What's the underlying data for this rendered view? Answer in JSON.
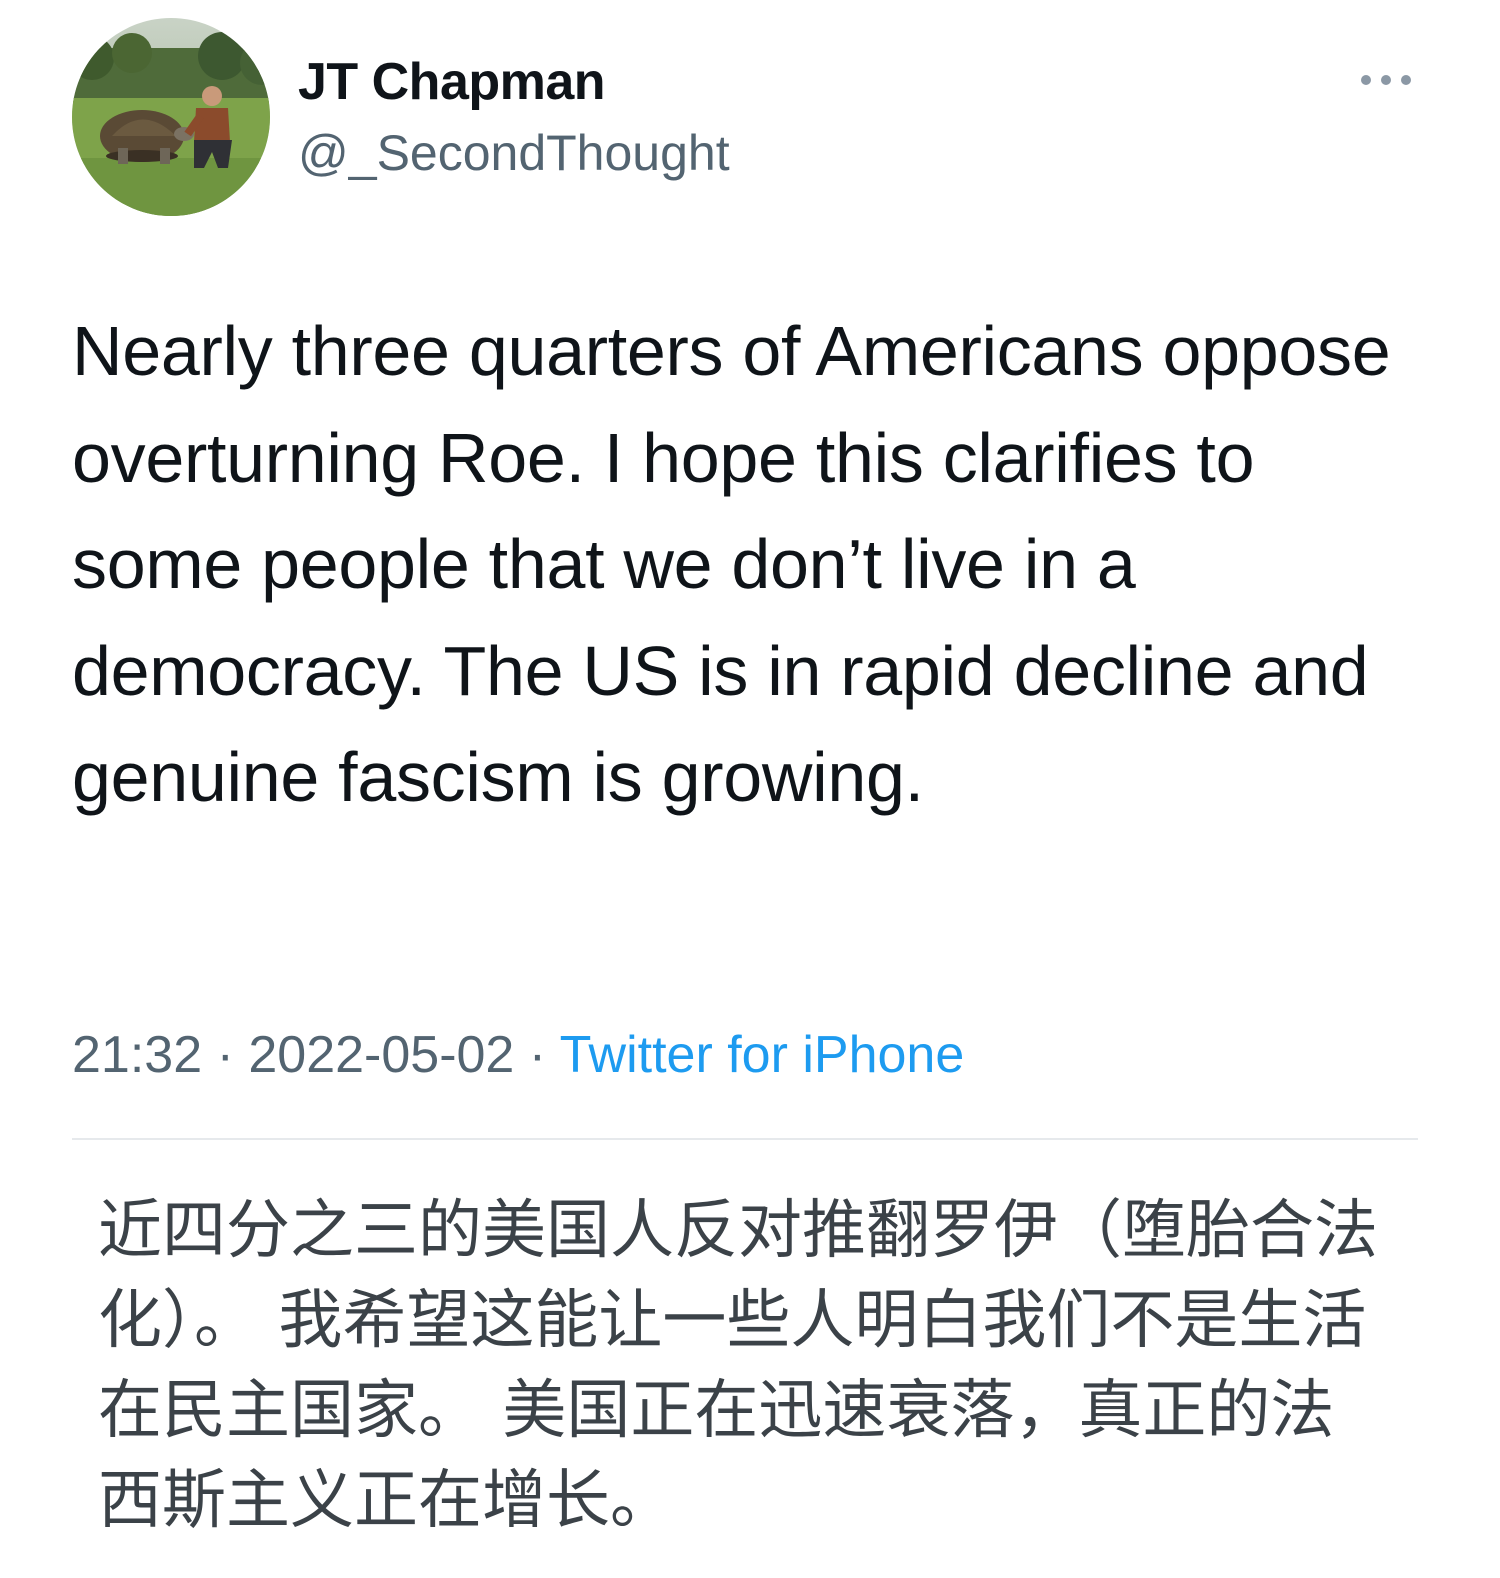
{
  "author": {
    "name": "JT Chapman",
    "handle": "@_SecondThought",
    "avatar_icon": "profile-photo-man-with-tortoise"
  },
  "more_icon": "more-options-icon",
  "tweet": {
    "text": "Nearly three quarters of Americans oppose overturning Roe. I hope this clarifies to some people that we don’t live in a democracy. The US is in rapid decline and genuine fascism is growing."
  },
  "meta": {
    "time": "21:32",
    "separator": " · ",
    "date": "2022-05-02",
    "source": "Twitter for iPhone"
  },
  "translation": {
    "text": "近四分之三的美国人反对推翻罗伊（堕胎合法化）。 我希望这能让一些人明白我们不是生活在民主国家。 美国正在迅速衰落，真正的法西斯主义正在增长。"
  },
  "colors": {
    "text_primary": "#0f1419",
    "text_secondary": "#536471",
    "link": "#1d9bf0",
    "translation_text": "#3b4248",
    "divider": "#e6e9ec"
  }
}
